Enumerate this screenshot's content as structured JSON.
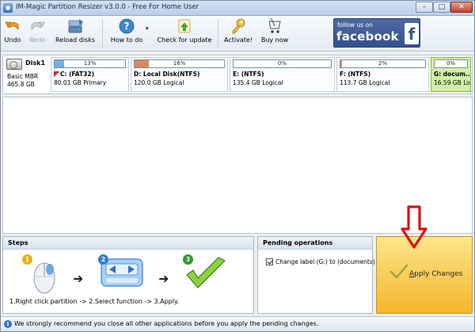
{
  "window": {
    "title": "IM-Magic Partition Resizer v3.0.0 - Free For Home User"
  },
  "toolbar": {
    "undo": "Undo",
    "redo": "Redo",
    "reload": "Reload disks",
    "howto": "How to do",
    "check_update": "Check for update",
    "activate": "Activate!",
    "buy_now": "Buy now",
    "facebook_small": "follow us on",
    "facebook_big": "facebook",
    "facebook_f": "f"
  },
  "disk": {
    "name": "Disk1",
    "type": "Basic MBR",
    "size": "465.8 GB",
    "partitions": [
      {
        "usage_label": "13%",
        "usage": 0.13,
        "fill_color": "#74aee8",
        "name": "C: (FAT32)",
        "desc": "80.01 GB Primary"
      },
      {
        "usage_label": "16%",
        "usage": 0.16,
        "fill_color": "#d98a5c",
        "name": "D: Local Disk(NTFS)",
        "desc": "120.0 GB Logical"
      },
      {
        "usage_label": "0%",
        "usage": 0.0,
        "fill_color": "#d98a5c",
        "name": "E: (NTFS)",
        "desc": "135.4 GB Logical"
      },
      {
        "usage_label": "2%",
        "usage": 0.02,
        "fill_color": "#d98a5c",
        "name": "F: (NTFS)",
        "desc": "113.7 GB Logical"
      },
      {
        "usage_label": "0%",
        "usage": 0.0,
        "fill_color": "#d98a5c",
        "name": "G: docum...",
        "desc": "16.59 GB Lo..."
      }
    ]
  },
  "steps": {
    "title": "Steps",
    "badges": [
      "1",
      "2",
      "3"
    ],
    "caption": "1.Right click partition -> 2.Select function -> 3.Apply."
  },
  "pending": {
    "title": "Pending operations",
    "items": [
      "Change label (G:) to (documents)"
    ]
  },
  "apply": {
    "label": "Apply Changes"
  },
  "status": {
    "text": "We strongly recommend you close all other applications before you apply the pending changes.",
    "info_glyph": "i"
  },
  "colors": {
    "accent": "#3b5998",
    "selected_partition": "#d2efa8",
    "apply_panel": "#f5b62c",
    "annotation_arrow": "#e01010"
  },
  "icons": [
    "undo-icon",
    "redo-icon",
    "reload-icon",
    "help-icon",
    "update-icon",
    "key-icon",
    "cart-icon",
    "disk-icon",
    "info-icon"
  ]
}
